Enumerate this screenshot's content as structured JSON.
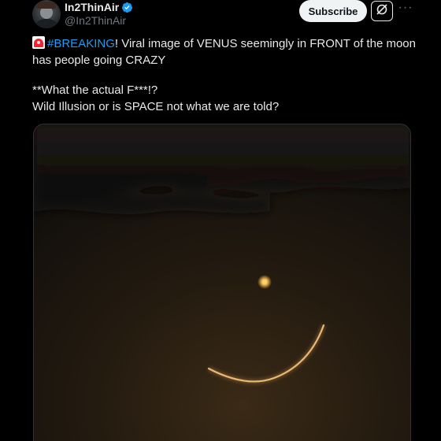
{
  "author": {
    "display_name": "In2ThinAir",
    "handle": "@In2ThinAir",
    "verified_icon": "verified-badge-icon",
    "avatar_icon": "avatar-photo"
  },
  "actions": {
    "subscribe_label": "Subscribe",
    "grok_icon": "grok-icon",
    "more_label": "···"
  },
  "tweet": {
    "siren_icon": "siren-emoji-icon",
    "hashtag": "#BREAKING",
    "line1_rest": "! Viral image of VENUS seemingly in FRONT of the moon",
    "line2": "has people going CRAZY",
    "line3": "**What the actual F***!?",
    "line4": "Wild Illusion or is SPACE not what we are told?"
  },
  "media": {
    "kind": "photo",
    "subject": "night-sky-crescent-moon-with-venus"
  },
  "colors": {
    "background": "#000000",
    "text": "#e7e9ea",
    "secondary": "#71767b",
    "link": "#1d9bf0",
    "verified": "#1d9bf0",
    "subscribe_bg": "#eff3f4"
  }
}
